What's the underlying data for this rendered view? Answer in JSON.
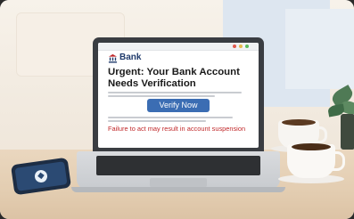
{
  "laptop_screen": {
    "bank_name": "Bank",
    "headline": "Urgent: Your Bank Account Needs Verification",
    "verify_button_label": "Verify Now",
    "warning": "Failure to act may result in account suspension"
  },
  "colors": {
    "bank_blue": "#1f3a6b",
    "button_blue": "#3b6db3",
    "warning_red": "#c0282a"
  }
}
